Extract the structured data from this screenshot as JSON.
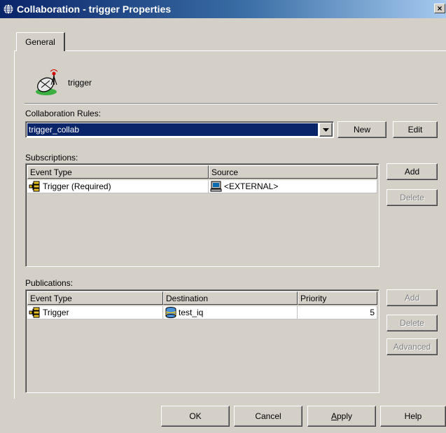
{
  "window": {
    "title": "Collaboration - trigger Properties",
    "close_label": "×"
  },
  "tabs": [
    {
      "label": "General",
      "active": true
    }
  ],
  "object": {
    "name": "trigger",
    "icon": "satellite-dish-icon"
  },
  "collab_rules": {
    "label": "Collaboration Rules:",
    "selected": "trigger_collab",
    "new_label": "New",
    "edit_label": "Edit"
  },
  "subscriptions": {
    "label": "Subscriptions:",
    "columns": [
      "Event Type",
      "Source"
    ],
    "rows": [
      {
        "event_type": "Trigger (Required)",
        "event_icon": "event-type-icon",
        "source": "<EXTERNAL>",
        "source_icon": "computer-icon"
      }
    ],
    "add_label": "Add",
    "delete_label": "Delete"
  },
  "publications": {
    "label": "Publications:",
    "columns": [
      "Event Type",
      "Destination",
      "Priority"
    ],
    "rows": [
      {
        "event_type": "Trigger",
        "event_icon": "event-type-icon",
        "destination": "test_iq",
        "destination_icon": "database-icon",
        "priority": "5"
      }
    ],
    "add_label": "Add",
    "delete_label": "Delete",
    "advanced_label": "Advanced"
  },
  "footer": {
    "ok_label": "OK",
    "cancel_label": "Cancel",
    "apply_label": "Apply",
    "apply_mnemonic": "A",
    "apply_rest": "pply",
    "help_label": "Help"
  },
  "colors": {
    "selection": "#0a246a",
    "face": "#d4d0c8",
    "title_gradient_start": "#0a246a",
    "title_gradient_end": "#a6caf0"
  }
}
